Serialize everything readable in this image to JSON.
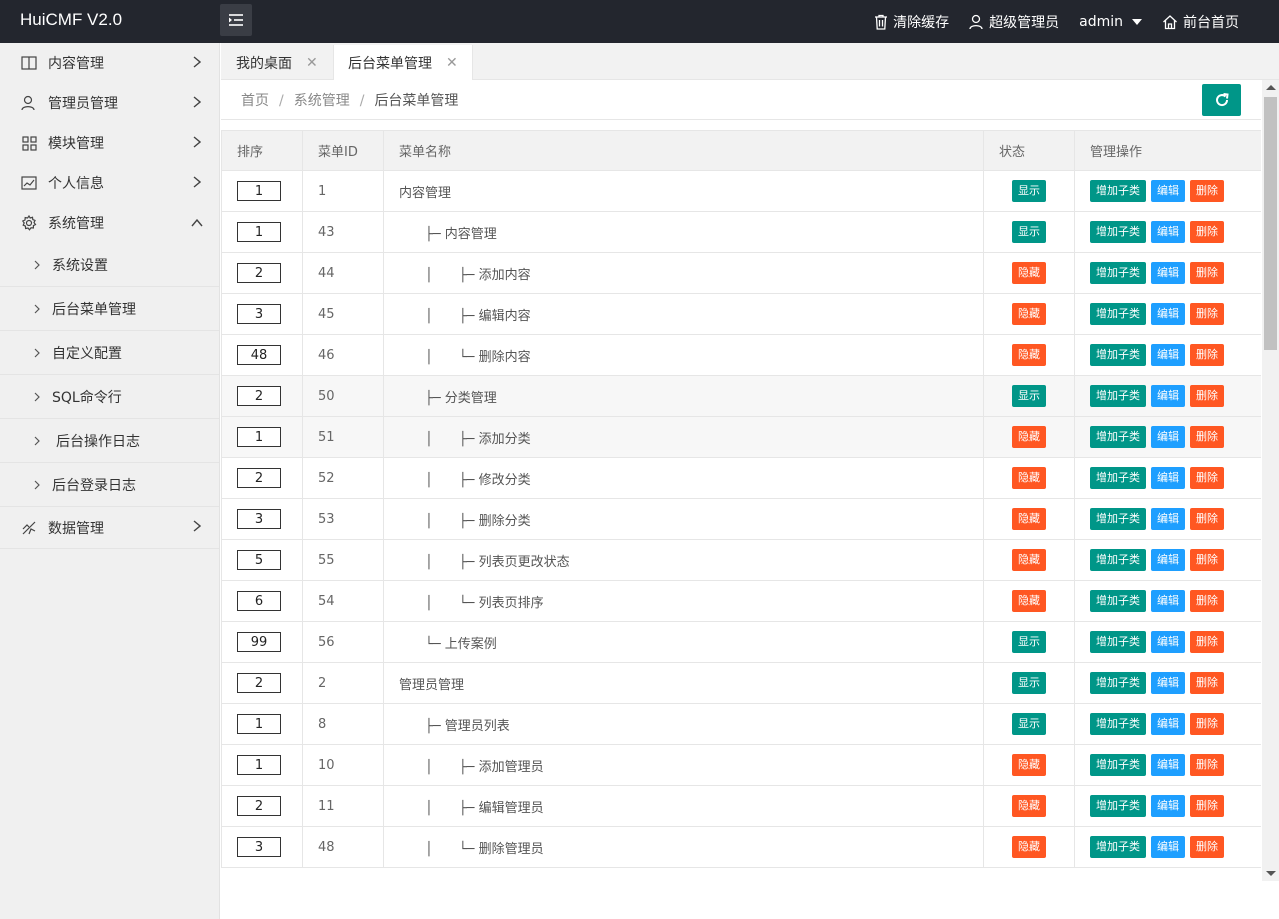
{
  "app": {
    "title": "HuiCMF V2.0"
  },
  "topbar": {
    "clear_cache": "清除缓存",
    "role": "超级管理员",
    "user": "admin",
    "home": "前台首页"
  },
  "sidebar": {
    "items": [
      {
        "label": "内容管理",
        "icon": "book-icon"
      },
      {
        "label": "管理员管理",
        "icon": "user-icon"
      },
      {
        "label": "模块管理",
        "icon": "grid-icon"
      },
      {
        "label": "个人信息",
        "icon": "card-icon"
      },
      {
        "label": "系统管理",
        "icon": "gear-icon"
      }
    ],
    "sub_items": [
      "系统设置",
      "后台菜单管理",
      "自定义配置",
      "SQL命令行",
      "后台操作日志",
      "后台登录日志"
    ],
    "data_item": {
      "label": "数据管理",
      "icon": "chart-icon"
    }
  },
  "tabs": [
    {
      "label": "我的桌面"
    },
    {
      "label": "后台菜单管理"
    }
  ],
  "breadcrumb": [
    "首页",
    "系统管理",
    "后台菜单管理"
  ],
  "table": {
    "headers": [
      "排序",
      "菜单ID",
      "菜单名称",
      "状态",
      "管理操作"
    ],
    "op_labels": {
      "add": "增加子类",
      "edit": "编辑",
      "delete": "删除"
    },
    "status_labels": {
      "show": "显示",
      "hide": "隐藏"
    },
    "rows": [
      {
        "sort": "1",
        "id": "1",
        "prefix": "",
        "name": "内容管理",
        "status": "显示"
      },
      {
        "sort": "1",
        "id": "43",
        "prefix": "├─ ",
        "name": "内容管理",
        "status": "显示"
      },
      {
        "sort": "2",
        "id": "44",
        "prefix": "│　　├─ ",
        "name": "添加内容",
        "status": "隐藏"
      },
      {
        "sort": "3",
        "id": "45",
        "prefix": "│　　├─ ",
        "name": "编辑内容",
        "status": "隐藏"
      },
      {
        "sort": "48",
        "id": "46",
        "prefix": "│　　└─ ",
        "name": "删除内容",
        "status": "隐藏"
      },
      {
        "sort": "2",
        "id": "50",
        "prefix": "├─ ",
        "name": "分类管理",
        "status": "显示"
      },
      {
        "sort": "1",
        "id": "51",
        "prefix": "│　　├─ ",
        "name": "添加分类",
        "status": "隐藏"
      },
      {
        "sort": "2",
        "id": "52",
        "prefix": "│　　├─ ",
        "name": "修改分类",
        "status": "隐藏"
      },
      {
        "sort": "3",
        "id": "53",
        "prefix": "│　　├─ ",
        "name": "删除分类",
        "status": "隐藏"
      },
      {
        "sort": "5",
        "id": "55",
        "prefix": "│　　├─ ",
        "name": "列表页更改状态",
        "status": "隐藏"
      },
      {
        "sort": "6",
        "id": "54",
        "prefix": "│　　└─ ",
        "name": "列表页排序",
        "status": "隐藏"
      },
      {
        "sort": "99",
        "id": "56",
        "prefix": "└─ ",
        "name": "上传案例",
        "status": "显示"
      },
      {
        "sort": "2",
        "id": "2",
        "prefix": "",
        "name": "管理员管理",
        "status": "显示"
      },
      {
        "sort": "1",
        "id": "8",
        "prefix": "├─ ",
        "name": "管理员列表",
        "status": "显示"
      },
      {
        "sort": "1",
        "id": "10",
        "prefix": "│　　├─ ",
        "name": "添加管理员",
        "status": "隐藏"
      },
      {
        "sort": "2",
        "id": "11",
        "prefix": "│　　├─ ",
        "name": "编辑管理员",
        "status": "隐藏"
      },
      {
        "sort": "3",
        "id": "48",
        "prefix": "│　　└─ ",
        "name": "删除管理员",
        "status": "隐藏"
      }
    ]
  },
  "colors": {
    "green": "#009688",
    "orange": "#ff5722",
    "blue": "#1e9fff",
    "topbar": "#23262e"
  }
}
